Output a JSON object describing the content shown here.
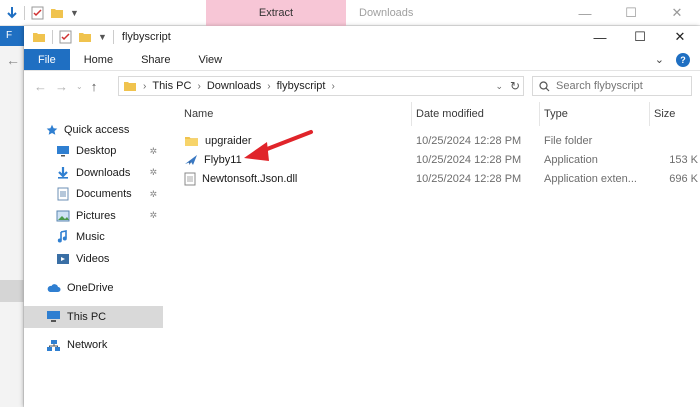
{
  "background_window": {
    "ribbon_context_tab": "Extract",
    "title": "Downloads",
    "file_tab_letter": "F"
  },
  "window": {
    "title": "flybyscript",
    "ribbon_tabs": [
      "File",
      "Home",
      "Share",
      "View"
    ],
    "address": {
      "segments": [
        "This PC",
        "Downloads",
        "flybyscript"
      ]
    },
    "search": {
      "placeholder": "Search flybyscript"
    }
  },
  "navpane": {
    "quick_access": "Quick access",
    "items": [
      {
        "label": "Desktop",
        "icon": "desktop-icon",
        "pinned": true
      },
      {
        "label": "Downloads",
        "icon": "downloads-icon",
        "pinned": true
      },
      {
        "label": "Documents",
        "icon": "documents-icon",
        "pinned": true
      },
      {
        "label": "Pictures",
        "icon": "pictures-icon",
        "pinned": true
      },
      {
        "label": "Music",
        "icon": "music-icon",
        "pinned": false
      },
      {
        "label": "Videos",
        "icon": "videos-icon",
        "pinned": false
      }
    ],
    "onedrive": "OneDrive",
    "this_pc": "This PC",
    "network": "Network"
  },
  "columns": {
    "name": "Name",
    "date": "Date modified",
    "type": "Type",
    "size": "Size"
  },
  "files": [
    {
      "name": "upgraider",
      "date": "10/25/2024 12:28 PM",
      "type": "File folder",
      "size": "",
      "icon": "folder-icon"
    },
    {
      "name": "Flyby11",
      "date": "10/25/2024 12:28 PM",
      "type": "Application",
      "size": "153 K",
      "icon": "app-icon"
    },
    {
      "name": "Newtonsoft.Json.dll",
      "date": "10/25/2024 12:28 PM",
      "type": "Application exten...",
      "size": "696 K",
      "icon": "dll-icon"
    }
  ],
  "colors": {
    "accent": "#1f6fc2",
    "extract_tab": "#f7c6d6",
    "annotation_arrow": "#e0242a",
    "folder": "#f0c34e"
  }
}
